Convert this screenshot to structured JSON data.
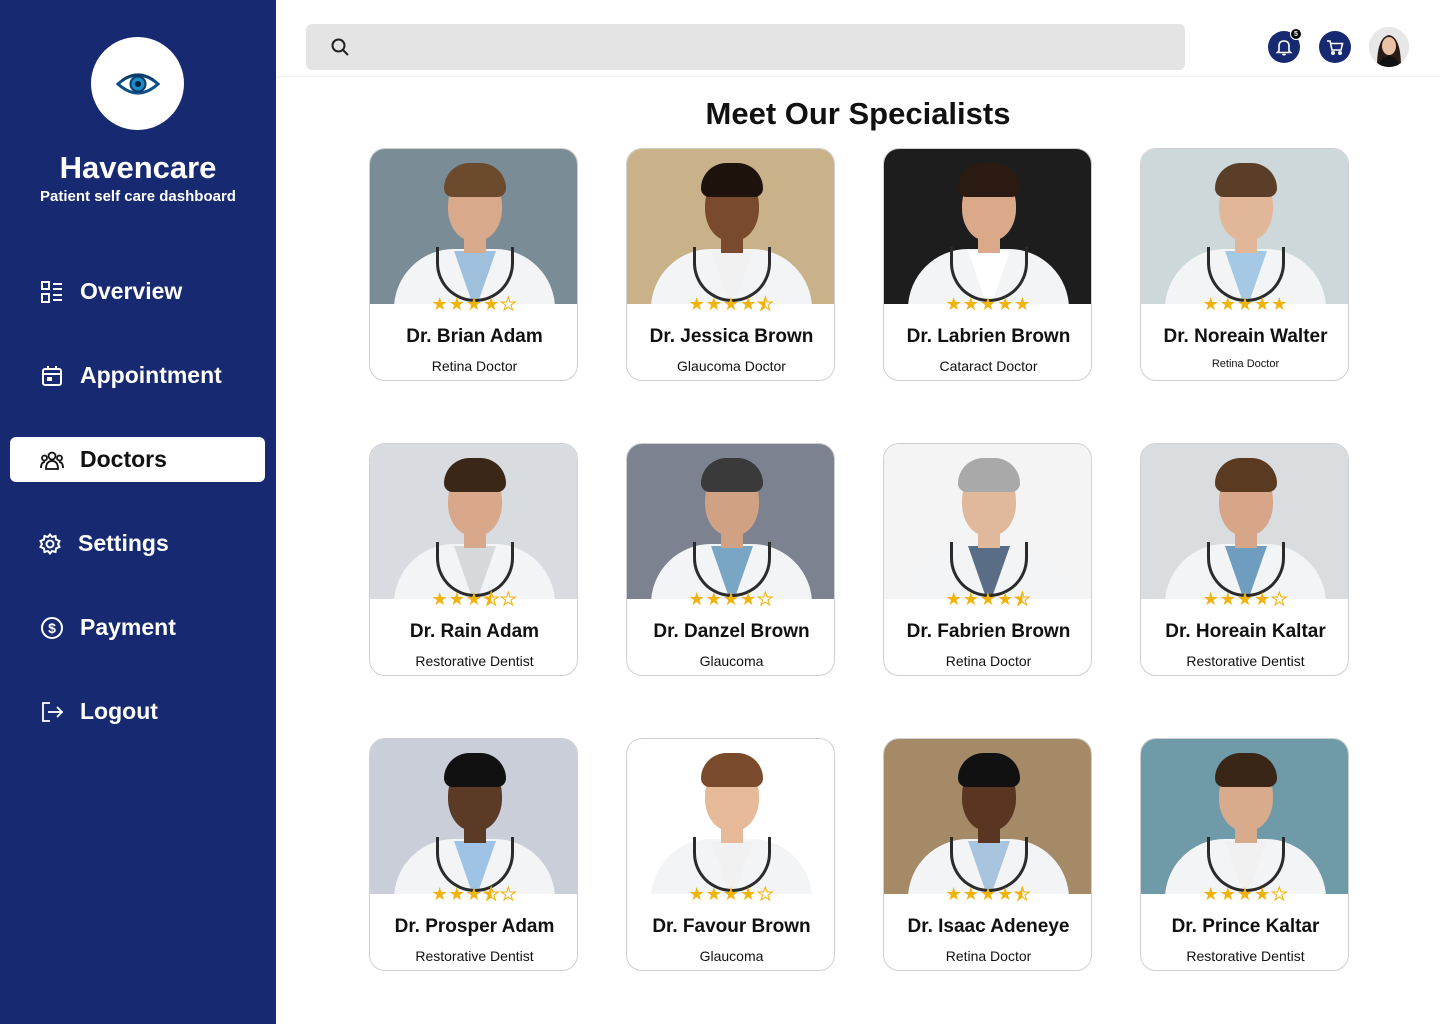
{
  "brand": {
    "name": "Havencare",
    "tagline": "Patient self care dashboard"
  },
  "nav": [
    {
      "label": "Overview",
      "icon": "dashboard-icon",
      "active": false
    },
    {
      "label": "Appointment",
      "icon": "calendar-icon",
      "active": false
    },
    {
      "label": "Doctors",
      "icon": "people-icon",
      "active": true
    },
    {
      "label": "Settings",
      "icon": "gear-icon",
      "active": false
    },
    {
      "label": "Payment",
      "icon": "dollar-circle-icon",
      "active": false
    },
    {
      "label": "Logout",
      "icon": "logout-icon",
      "active": false
    }
  ],
  "header": {
    "search_placeholder": "",
    "notification_count": "5"
  },
  "main": {
    "title": "Meet Our Specialists",
    "doctors": [
      {
        "name": "Dr. Brian Adam",
        "specialty": "Retina Doctor",
        "rating": 4
      },
      {
        "name": "Dr. Jessica Brown",
        "specialty": "Glaucoma Doctor",
        "rating": 4.5
      },
      {
        "name": "Dr. Labrien Brown",
        "specialty": "Cataract Doctor",
        "rating": 5
      },
      {
        "name": "Dr. Noreain Walter",
        "specialty": "Retina Doctor",
        "rating": 5
      },
      {
        "name": "Dr. Rain Adam",
        "specialty": "Restorative Dentist",
        "rating": 3.5
      },
      {
        "name": "Dr. Danzel Brown",
        "specialty": "Glaucoma",
        "rating": 4
      },
      {
        "name": "Dr. Fabrien Brown",
        "specialty": "Retina Doctor",
        "rating": 4.5
      },
      {
        "name": "Dr. Horeain Kaltar",
        "specialty": "Restorative Dentist",
        "rating": 4
      },
      {
        "name": "Dr. Prosper Adam",
        "specialty": "Restorative Dentist",
        "rating": 3.5
      },
      {
        "name": "Dr. Favour Brown",
        "specialty": "Glaucoma",
        "rating": 4
      },
      {
        "name": "Dr. Isaac Adeneye",
        "specialty": "Retina Doctor",
        "rating": 4.5
      },
      {
        "name": "Dr. Prince Kaltar",
        "specialty": "Restorative Dentist",
        "rating": 4
      }
    ]
  },
  "colors": {
    "sidebar": "#172a71",
    "star": "#f1b20a",
    "search_bg": "#e4e4e4"
  }
}
